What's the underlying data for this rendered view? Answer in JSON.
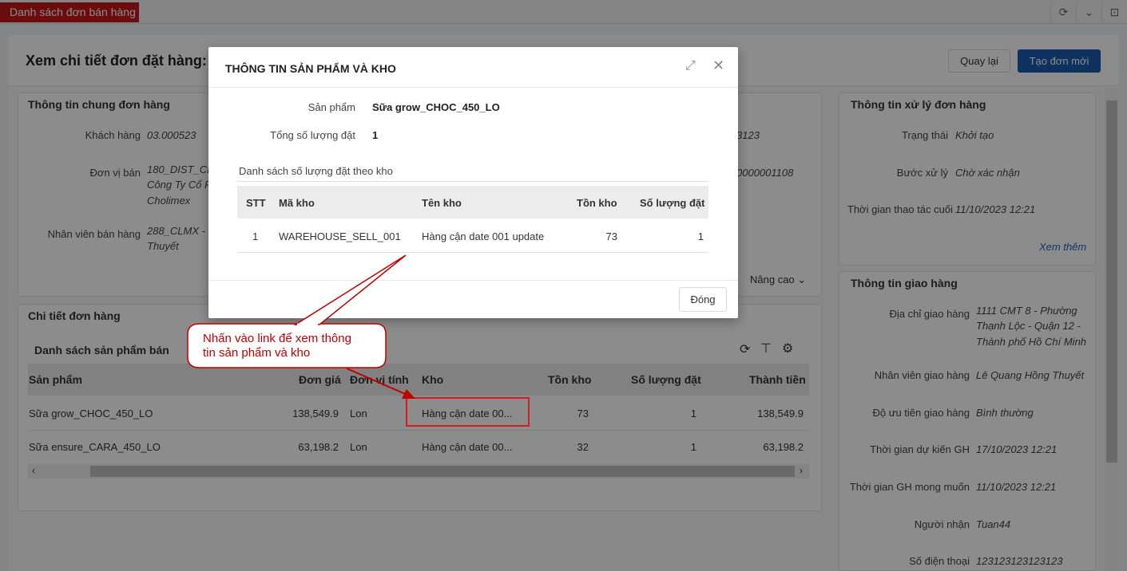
{
  "topbar": {
    "tab_label": "Danh sách đơn bán hàng",
    "icons": [
      "refresh-icon",
      "chevron-down-icon",
      "window-icon"
    ]
  },
  "header": {
    "title": "Xem chi tiết đơn đặt hàng:",
    "back_label": "Quay lại",
    "new_label": "Tạo đơn mới"
  },
  "general": {
    "title": "Thông tin chung đơn hàng",
    "customer_label": "Khách hàng",
    "customer_value": "03.000523",
    "unit_label": "Đơn vị bán",
    "unit_value_1": "180_DIST_CL",
    "unit_value_2": "Công Ty Cổ P",
    "unit_value_3": "Cholimex",
    "staff_label": "Nhân viên bán hàng",
    "staff_value_1": "288_CLMX - L",
    "staff_value_2": "Thuyết",
    "right_value_1": "3123",
    "right_value_2": "0000001108",
    "advanced_label": "Nâng cao"
  },
  "processing": {
    "title": "Thông tin xử lý đơn hàng",
    "status_label": "Trạng thái",
    "status_value": "Khởi tạo",
    "step_label": "Bước xử lý",
    "step_value": "Chờ xác nhận",
    "last_label": "Thời gian thao tác cuối",
    "last_value": "11/10/2023 12:21",
    "more_label": "Xem thêm"
  },
  "delivery": {
    "title": "Thông tin giao hàng",
    "address_label": "Địa chỉ giao hàng",
    "address_1": "1111 CMT 8 - Phường",
    "address_2": "Thạnh Lộc - Quận 12 -",
    "address_3": "Thành phố Hồ Chí Minh",
    "deliverer_label": "Nhân viên giao hàng",
    "deliverer_value": "Lê Quang Hồng Thuyết",
    "priority_label": "Độ ưu tiên giao hàng",
    "priority_value": "Bình thường",
    "expected_label": "Thời gian dự kiến GH",
    "expected_value": "17/10/2023 12:21",
    "desired_label": "Thời gian GH mong muốn",
    "desired_value": "11/10/2023 12:21",
    "receiver_label": "Người nhận",
    "receiver_value": "Tuan44",
    "phone_label": "Số điện thoại",
    "phone_value": "123123123123123"
  },
  "detail": {
    "title": "Chi tiết đơn hàng",
    "list_title": "Danh sách sản phẩm bán",
    "columns": [
      "Sản phẩm",
      "Đơn giá",
      "Đơn vị tính",
      "Kho",
      "Tồn kho",
      "Số lượng đặt",
      "Thành tiền"
    ],
    "rows": [
      {
        "product": "Sữa grow_CHOC_450_LO",
        "price": "138,549.9",
        "unit": "Lon",
        "warehouse": "Hàng cận date 00...",
        "stock": "73",
        "qty": "1",
        "total": "138,549.9"
      },
      {
        "product": "Sữa ensure_CARA_450_LO",
        "price": "63,198.2",
        "unit": "Lon",
        "warehouse": "Hàng cận date 00...",
        "stock": "32",
        "qty": "1",
        "total": "63,198.2"
      }
    ]
  },
  "modal": {
    "title": "THÔNG TIN SẢN PHẨM VÀ KHO",
    "product_label": "Sản phẩm",
    "product_value": "Sữa grow_CHOC_450_LO",
    "total_label": "Tổng số lượng đặt",
    "total_value": "1",
    "subtitle": "Danh sách số lượng đặt theo kho",
    "columns": [
      "STT",
      "Mã kho",
      "Tên kho",
      "Tồn kho",
      "Số lượng đặt"
    ],
    "row": {
      "stt": "1",
      "code": "WAREHOUSE_SELL_001",
      "name": "Hàng cận date 001 update",
      "stock": "73",
      "qty": "1"
    },
    "close_label": "Đóng"
  },
  "annotation": {
    "text_line_1": "Nhấn vào link để xem thông",
    "text_line_2": "tin sản phẩm và kho",
    "color": "#c00000"
  }
}
